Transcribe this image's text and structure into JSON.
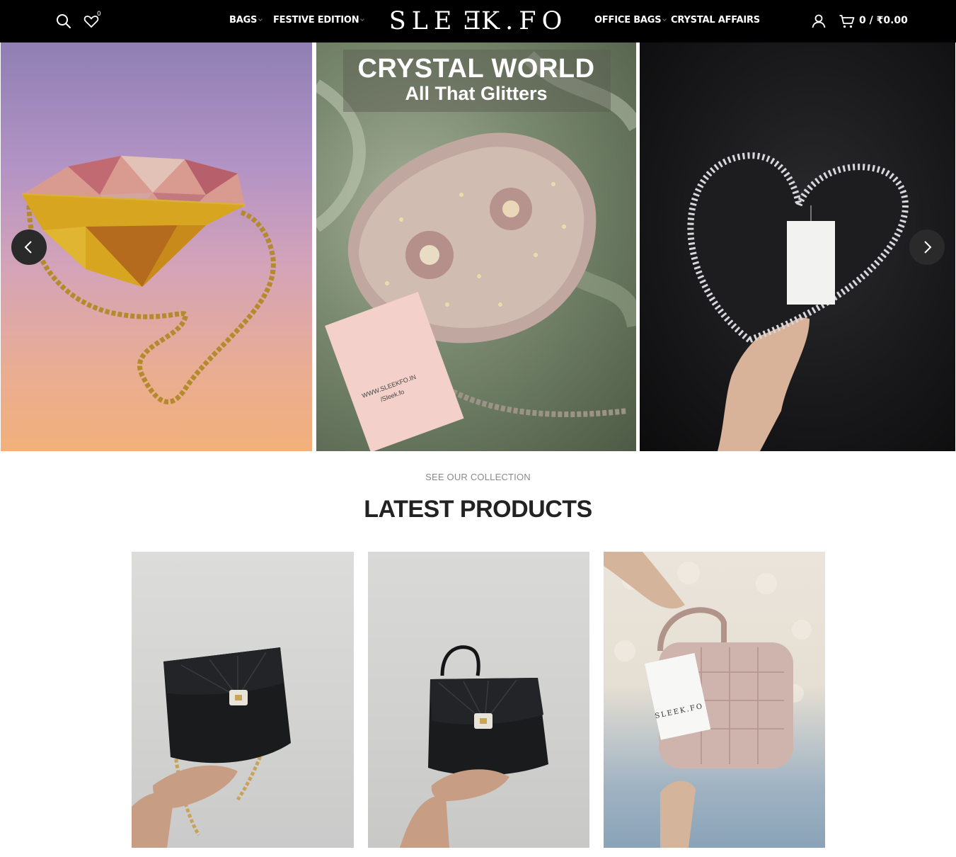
{
  "header": {
    "logo": {
      "part1": "SLE",
      "mirrored": "E",
      "part2": "K.FO"
    },
    "wishlist_count": "0",
    "nav_left": [
      {
        "label": "BAGS"
      },
      {
        "label": "FESTIVE EDITION"
      }
    ],
    "nav_right": [
      {
        "label": "OFFICE BAGS"
      },
      {
        "label": "CRYSTAL AFFAIRS"
      }
    ],
    "cart_summary": "0 / ₹0.00"
  },
  "hero": {
    "slides": [
      {
        "image": "diamond-crystal-clutch"
      },
      {
        "image": "crystal-embellished-clutch",
        "title": "CRYSTAL WORLD",
        "subtitle": "All That Glitters",
        "tag": {
          "site": "WWW.SLEEKFO.IN",
          "handle": "/Sleek.fo"
        }
      },
      {
        "image": "heart-crystal-bag"
      }
    ]
  },
  "section": {
    "eyebrow": "SEE OUR COLLECTION",
    "title": "LATEST PRODUCTS"
  },
  "products": [
    {
      "image": "black-chain-shoulder-bag"
    },
    {
      "image": "black-top-handle-bag"
    },
    {
      "image": "pink-quilted-box-bag",
      "tag_brand": "SLEEK.FO"
    }
  ],
  "colors": {
    "header_bg": "#000000",
    "header_text": "#ffffff",
    "title_text": "#222222",
    "eyebrow_text": "#8a8a8a"
  }
}
